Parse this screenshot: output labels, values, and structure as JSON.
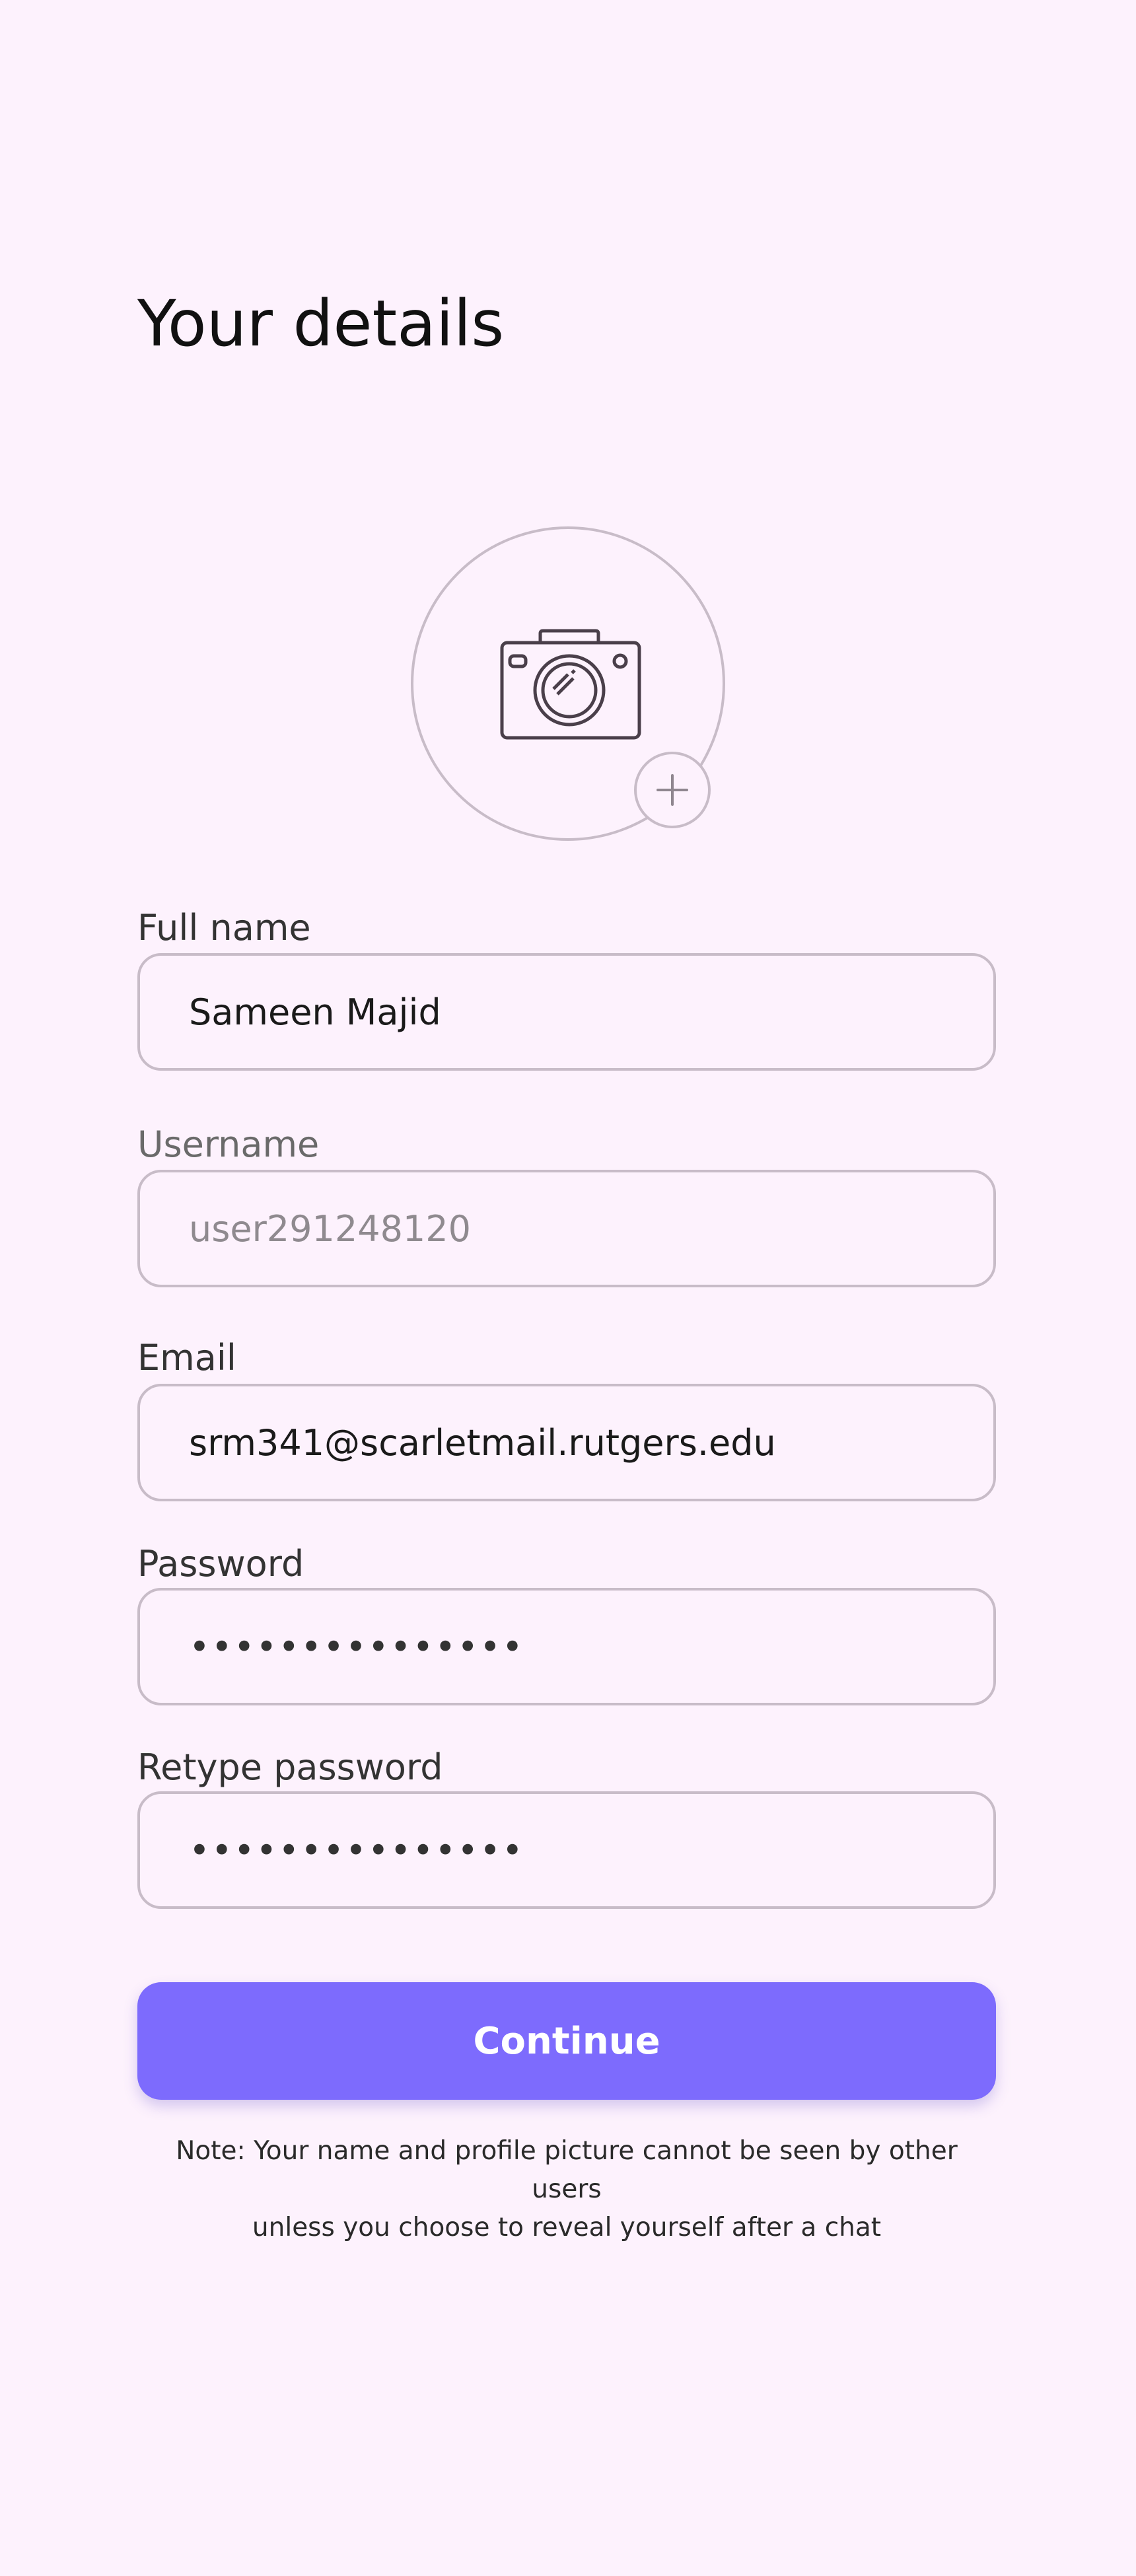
{
  "header": {
    "title": "Your details"
  },
  "profile_picture": {
    "icon": "camera-icon",
    "add_icon": "plus-icon"
  },
  "form": {
    "full_name": {
      "label": "Full name",
      "value": "Sameen Majid"
    },
    "username": {
      "label": "Username",
      "placeholder": "user291248120"
    },
    "email": {
      "label": "Email",
      "value": "srm341@scarletmail.rutgers.edu"
    },
    "password": {
      "label": "Password",
      "value": "•••••••••••••••"
    },
    "retype_password": {
      "label": "Retype password",
      "value": "•••••••••••••••"
    }
  },
  "actions": {
    "continue_label": "Continue"
  },
  "note": {
    "line1": "Note: Your name and profile picture cannot be seen by other users",
    "line2": "unless you choose to reveal yourself after a chat"
  },
  "colors": {
    "background": "#fdf2fd",
    "accent": "#7d6bfd",
    "border": "#c8bcc8"
  }
}
